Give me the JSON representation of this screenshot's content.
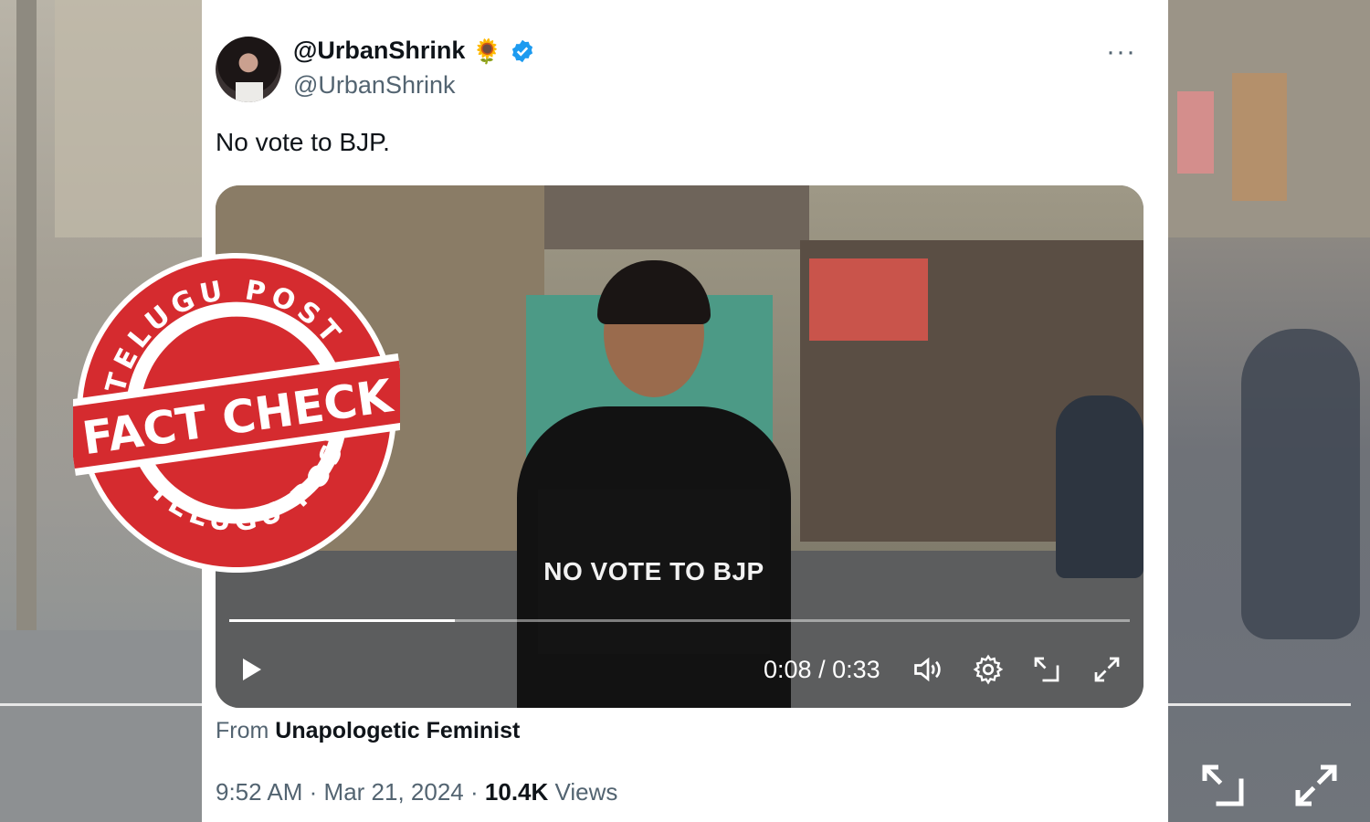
{
  "tweet": {
    "display_name": "@UrbanShrink",
    "emoji": "🌻",
    "handle": "@UrbanShrink",
    "text": "No vote to BJP.",
    "more_icon": "···"
  },
  "video": {
    "board_text": "NO VOTE TO BJP",
    "current_time": "0:08",
    "separator": "/",
    "duration": "0:33",
    "progress": 0.25
  },
  "source": {
    "prefix": "From",
    "name": "Unapologetic Feminist"
  },
  "meta": {
    "time": "9:52 AM",
    "dot": "·",
    "date": "Mar 21, 2024",
    "views_count": "10.4K",
    "views_label": "Views"
  },
  "stamp": {
    "top_text": "TELUGU POST",
    "center_text": "FACT CHECK",
    "bottom_text": "TELUGU POST",
    "color": "#d52b2f"
  },
  "colors": {
    "verified": "#1d9bf0",
    "text_primary": "#0f1419",
    "text_secondary": "#536471"
  }
}
